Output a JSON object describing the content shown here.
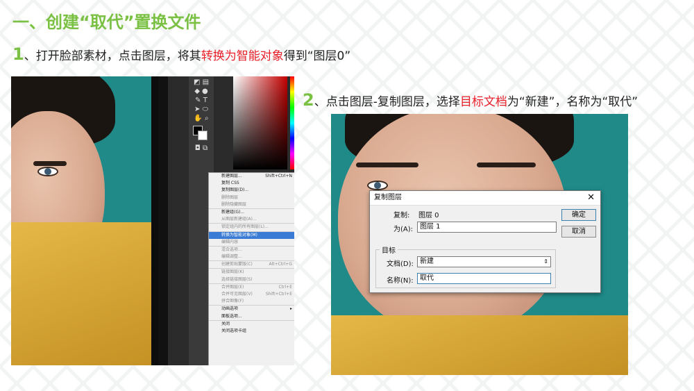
{
  "title": "一、创建“取代”置换文件",
  "step1": {
    "num": "1",
    "text_a": "、打开脸部素材，点击图层，将其",
    "highlight": "转换为智能对象",
    "text_b": "得到“图层0”"
  },
  "step2": {
    "num": "2",
    "text_a": "、点击图层-复制图层，选择",
    "highlight": "目标文档",
    "text_b": "为“新建”，名称为“取代”"
  },
  "ps_menu": {
    "items": [
      {
        "label": "新建图层...",
        "shortcut": "Shift+Ctrl+N",
        "state": "normal"
      },
      {
        "label": "复制 CSS",
        "shortcut": "",
        "state": "normal"
      },
      {
        "label": "复制图层(D)...",
        "shortcut": "",
        "state": "normal"
      },
      {
        "label": "删除图层",
        "shortcut": "",
        "state": "dis"
      },
      {
        "label": "删除隐藏图层",
        "shortcut": "",
        "state": "dis"
      },
      {
        "label": "新建组(G)...",
        "shortcut": "",
        "state": "normal",
        "sep": true
      },
      {
        "label": "从图层新建组(A)...",
        "shortcut": "",
        "state": "dis"
      },
      {
        "label": "锁定组内的所有图层(L)...",
        "shortcut": "",
        "state": "dis",
        "sep": true
      },
      {
        "label": "转换为智能对象(M)",
        "shortcut": "",
        "state": "sel",
        "sep": true
      },
      {
        "label": "编辑内容",
        "shortcut": "",
        "state": "dis"
      },
      {
        "label": "混合选项...",
        "shortcut": "",
        "state": "dis",
        "sep": true
      },
      {
        "label": "编辑调整...",
        "shortcut": "",
        "state": "dis"
      },
      {
        "label": "创建剪贴蒙版(C)",
        "shortcut": "Alt+Ctrl+G",
        "state": "dis",
        "sep": true
      },
      {
        "label": "链接图层(K)",
        "shortcut": "",
        "state": "dis",
        "sep": true
      },
      {
        "label": "选择链接图层(S)",
        "shortcut": "",
        "state": "dis"
      },
      {
        "label": "合并图层(E)",
        "shortcut": "Ctrl+E",
        "state": "dis",
        "sep": true
      },
      {
        "label": "合并可见图层(V)",
        "shortcut": "Shift+Ctrl+E",
        "state": "dis"
      },
      {
        "label": "拼合图像(F)",
        "shortcut": "",
        "state": "dis"
      },
      {
        "label": "动画选项",
        "shortcut": "▸",
        "state": "normal",
        "sep": true
      },
      {
        "label": "面板选项...",
        "shortcut": "",
        "state": "normal"
      },
      {
        "label": "关闭",
        "shortcut": "",
        "state": "normal",
        "sep": true
      },
      {
        "label": "关闭选项卡组",
        "shortcut": "",
        "state": "normal"
      }
    ]
  },
  "dialog": {
    "title": "复制图层",
    "close": "✕",
    "copy_label": "复制:",
    "copy_value": "图层 0",
    "as_label": "为(A):",
    "as_value": "图层 1",
    "group_label": "目标",
    "doc_label": "文档(D):",
    "doc_value": "新建",
    "name_label": "名称(N):",
    "name_value": "取代",
    "ok": "确定",
    "cancel": "取消"
  }
}
